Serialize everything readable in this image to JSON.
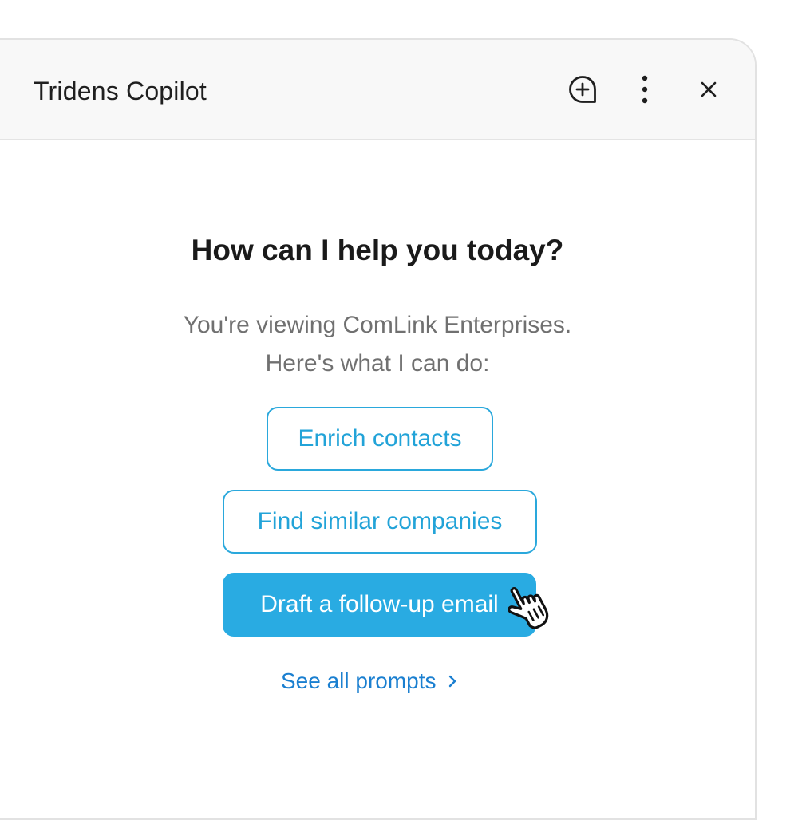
{
  "header": {
    "title": "Tridens Copilot",
    "icons": {
      "new_chat": "plus-circle-icon",
      "more": "more-vertical-icon",
      "close": "close-icon"
    }
  },
  "main": {
    "heading": "How can I help you today?",
    "subtext_line1": "You're viewing ComLink Enterprises.",
    "subtext_line2": "Here's what I can do:",
    "prompts": [
      {
        "label": "Enrich contacts",
        "selected": false
      },
      {
        "label": "Find similar companies",
        "selected": false
      },
      {
        "label": "Draft a follow-up email",
        "selected": true
      }
    ],
    "see_all_label": "See all prompts"
  },
  "colors": {
    "accent": "#29abe2",
    "link": "#1a7fd0",
    "header_bg": "#f8f8f8"
  }
}
